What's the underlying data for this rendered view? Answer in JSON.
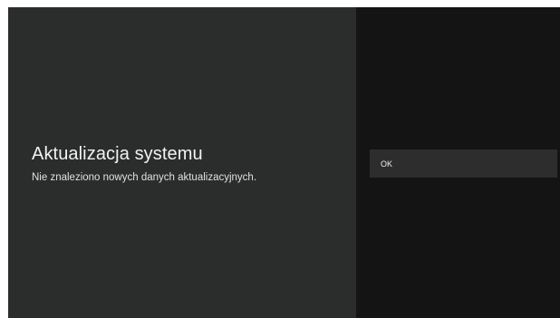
{
  "dialog": {
    "title": "Aktualizacja systemu",
    "message": "Nie znaleziono nowych danych aktualizacyjnych."
  },
  "actions": {
    "ok_label": "OK"
  },
  "colors": {
    "left_panel_bg": "#2b2c2c",
    "right_panel_bg": "#141414",
    "button_bg": "#2d2d2d",
    "text": "#f2f2f2"
  }
}
